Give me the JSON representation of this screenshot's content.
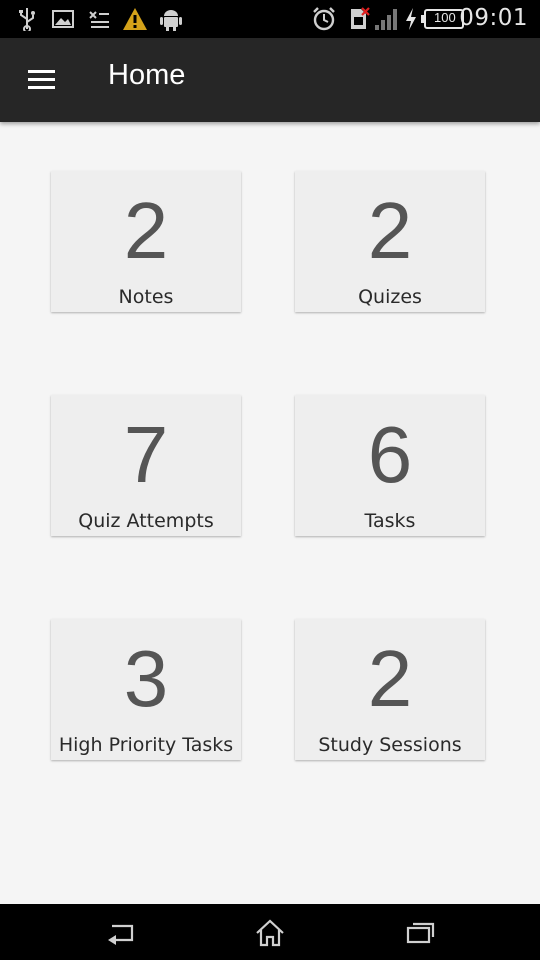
{
  "status_bar": {
    "time": "09:01",
    "battery_level": "100",
    "icons": [
      "usb-icon",
      "image-icon",
      "sim-disabled-icon",
      "warning-icon",
      "android-icon",
      "alarm-icon",
      "no-sim-icon",
      "signal-icon",
      "charging-icon",
      "battery-icon"
    ]
  },
  "toolbar": {
    "title": "Home",
    "menu_icon": "hamburger-menu-icon"
  },
  "cards": [
    {
      "count": "2",
      "label": "Notes"
    },
    {
      "count": "2",
      "label": "Quizes"
    },
    {
      "count": "7",
      "label": "Quiz Attempts"
    },
    {
      "count": "6",
      "label": "Tasks"
    },
    {
      "count": "3",
      "label": "High Priority Tasks"
    },
    {
      "count": "2",
      "label": "Study Sessions"
    }
  ],
  "nav_bar": {
    "icons": [
      "back-icon",
      "home-icon",
      "recent-apps-icon"
    ]
  }
}
